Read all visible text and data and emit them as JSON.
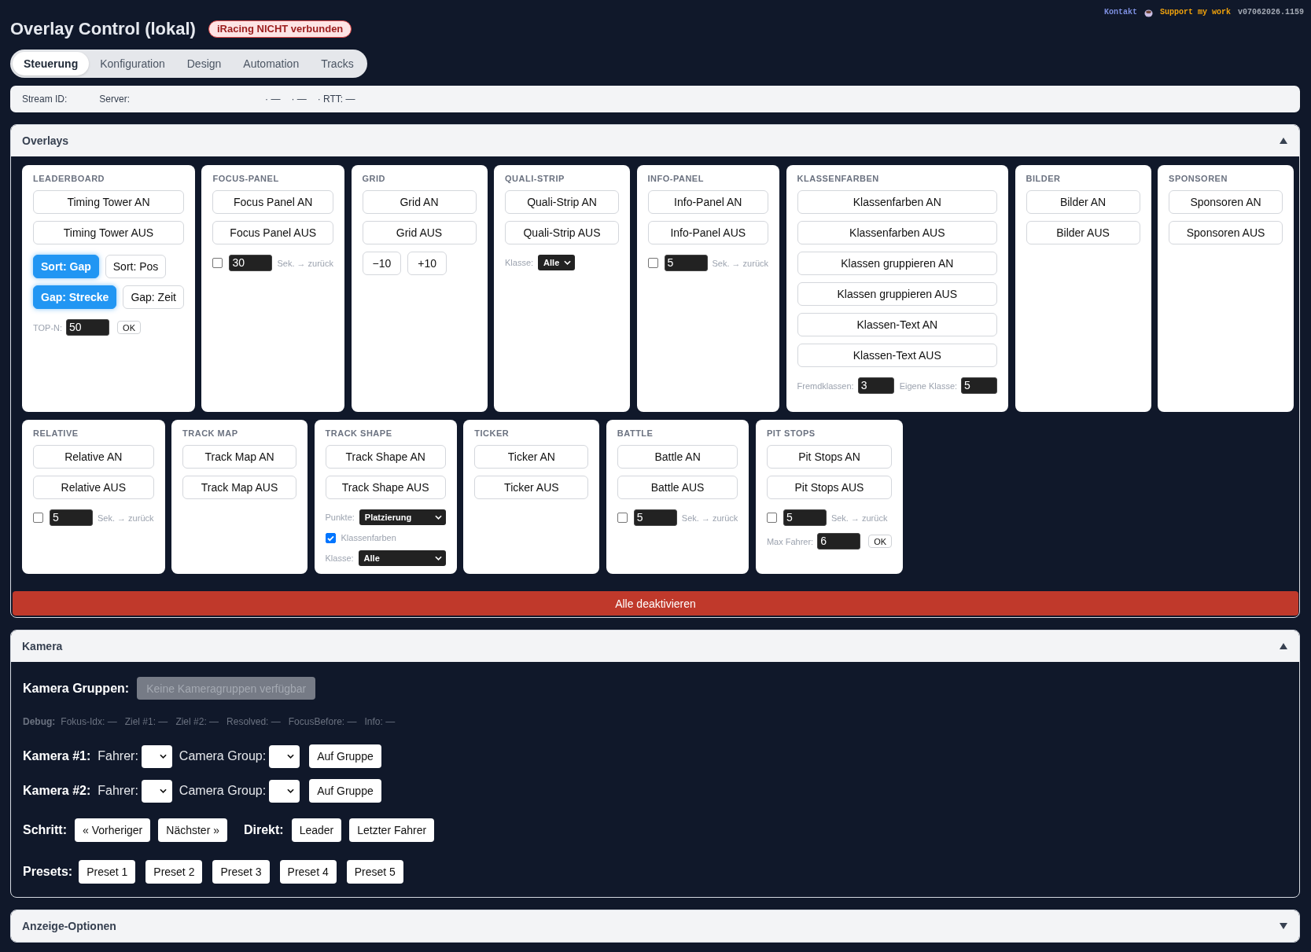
{
  "header": {
    "title": "Overlay Control (lokal)",
    "status_badge": "iRacing NICHT verbunden",
    "links": [
      {
        "kind": "contact",
        "text": "Kontakt"
      },
      {
        "kind": "support",
        "text": "Support my work"
      }
    ],
    "version": "v07062026.1159"
  },
  "tabs": [
    {
      "label": "Steuerung",
      "selected": true
    },
    {
      "label": "Konfiguration",
      "selected": false
    },
    {
      "label": "Design",
      "selected": false
    },
    {
      "label": "Automation",
      "selected": false
    },
    {
      "label": "Tracks",
      "selected": false
    }
  ],
  "stream_bar": {
    "labels": [
      "Stream ID:",
      "Server:"
    ],
    "indicators": [
      "· —",
      "· —",
      "· RTT: —"
    ]
  },
  "overlays": {
    "title": "Overlays",
    "expanded": true,
    "card_rows": [
      [
        {
          "title": "LEADERBOARD",
          "controls": [
            {
              "kind": "button",
              "label": "Timing Tower AN"
            },
            {
              "kind": "button",
              "label": "Timing Tower AUS"
            },
            {
              "kind": "toggles",
              "buttons": [
                {
                  "label": "Sort: Gap",
                  "selected": true
                },
                {
                  "label": "Sort: Pos",
                  "selected": false
                }
              ]
            },
            {
              "kind": "toggles",
              "buttons": [
                {
                  "label": "Gap: Strecke",
                  "selected": true
                },
                {
                  "label": "Gap: Zeit",
                  "selected": false
                }
              ]
            },
            {
              "kind": "number",
              "label": "TOP-N:",
              "value": "50",
              "button": "OK"
            }
          ]
        },
        {
          "title": "FOCUS-PANEL",
          "controls": [
            {
              "kind": "button",
              "label": "Focus Panel AN"
            },
            {
              "kind": "button",
              "label": "Focus Panel AUS"
            },
            {
              "kind": "timer",
              "checked": false,
              "value": "30",
              "suffix": "Sek. → zurück"
            }
          ]
        },
        {
          "title": "GRID",
          "controls": [
            {
              "kind": "button",
              "label": "Grid AN"
            },
            {
              "kind": "button",
              "label": "Grid AUS"
            },
            {
              "kind": "steps",
              "buttons": [
                "−10",
                "+10"
              ]
            }
          ]
        },
        {
          "title": "QUALI-STRIP",
          "controls": [
            {
              "kind": "button",
              "label": "Quali-Strip AN"
            },
            {
              "kind": "button",
              "label": "Quali-Strip AUS"
            },
            {
              "kind": "select",
              "label": "Klasse:",
              "value": "Alle"
            }
          ]
        },
        {
          "title": "INFO-PANEL",
          "controls": [
            {
              "kind": "button",
              "label": "Info-Panel AN"
            },
            {
              "kind": "button",
              "label": "Info-Panel AUS"
            },
            {
              "kind": "timer",
              "checked": false,
              "value": "5",
              "suffix": "Sek. → zurück"
            }
          ]
        },
        {
          "title": "KLASSENFARBEN",
          "controls": [
            {
              "kind": "button",
              "label": "Klassenfarben AN"
            },
            {
              "kind": "button",
              "label": "Klassenfarben AUS"
            },
            {
              "kind": "button",
              "label": "Klassen gruppieren AN"
            },
            {
              "kind": "button",
              "label": "Klassen gruppieren AUS"
            },
            {
              "kind": "button",
              "label": "Klassen-Text AN"
            },
            {
              "kind": "button",
              "label": "Klassen-Text AUS"
            },
            {
              "kind": "fields",
              "fields": [
                {
                  "label": "Fremdklassen:",
                  "value": "3"
                },
                {
                  "label": "Eigene Klasse:",
                  "value": "5"
                }
              ]
            }
          ]
        },
        {
          "title": "BILDER",
          "controls": [
            {
              "kind": "button",
              "label": "Bilder AN"
            },
            {
              "kind": "button",
              "label": "Bilder AUS"
            }
          ]
        },
        {
          "title": "SPONSOREN",
          "controls": [
            {
              "kind": "button",
              "label": "Sponsoren AN"
            },
            {
              "kind": "button",
              "label": "Sponsoren AUS"
            }
          ]
        }
      ],
      [
        {
          "title": "RELATIVE",
          "controls": [
            {
              "kind": "button",
              "label": "Relative AN"
            },
            {
              "kind": "button",
              "label": "Relative AUS"
            },
            {
              "kind": "timer",
              "checked": false,
              "value": "5",
              "suffix": "Sek. → zurück"
            }
          ]
        },
        {
          "title": "TRACK MAP",
          "controls": [
            {
              "kind": "button",
              "label": "Track Map AN"
            },
            {
              "kind": "button",
              "label": "Track Map AUS"
            }
          ]
        },
        {
          "title": "TRACK SHAPE",
          "controls": [
            {
              "kind": "button",
              "label": "Track Shape AN"
            },
            {
              "kind": "button",
              "label": "Track Shape AUS"
            },
            {
              "kind": "wideselect",
              "label": "Punkte:",
              "value": "Platzierung"
            },
            {
              "kind": "checkbox",
              "checked": true,
              "label": "Klassenfarben"
            },
            {
              "kind": "wideselect",
              "label": "Klasse:",
              "value": "Alle"
            }
          ]
        },
        {
          "title": "TICKER",
          "controls": [
            {
              "kind": "button",
              "label": "Ticker AN"
            },
            {
              "kind": "button",
              "label": "Ticker AUS"
            }
          ]
        },
        {
          "title": "BATTLE",
          "controls": [
            {
              "kind": "button",
              "label": "Battle AN"
            },
            {
              "kind": "button",
              "label": "Battle AUS"
            },
            {
              "kind": "timer",
              "checked": false,
              "value": "5",
              "suffix": "Sek. → zurück"
            }
          ]
        },
        {
          "title": "PIT STOPS",
          "controls": [
            {
              "kind": "button",
              "label": "Pit Stops AN"
            },
            {
              "kind": "button",
              "label": "Pit Stops AUS"
            },
            {
              "kind": "timer",
              "checked": false,
              "value": "5",
              "suffix": "Sek. → zurück"
            },
            {
              "kind": "number",
              "label": "Max Fahrer:",
              "value": "6",
              "button": "OK"
            }
          ]
        }
      ]
    ],
    "disable_all_button": "Alle deaktivieren"
  },
  "kamera": {
    "title": "Kamera",
    "expanded": true,
    "groups": {
      "label": "Kamera Gruppen:",
      "button": "Keine Kameragruppen verfügbar",
      "disabled": true
    },
    "debug": {
      "label": "Debug:",
      "items": [
        "Fokus-Idx: —",
        "Ziel #1: —",
        "Ziel #2: —",
        "Resolved: —",
        "FocusBefore: —",
        "Info: —"
      ]
    },
    "cameras": [
      {
        "label": "Kamera #1:",
        "driver_label": "Fahrer:",
        "group_label": "Camera Group:",
        "button": "Auf Gruppe"
      },
      {
        "label": "Kamera #2:",
        "driver_label": "Fahrer:",
        "group_label": "Camera Group:",
        "button": "Auf Gruppe"
      }
    ],
    "navigation": [
      {
        "label": "Schritt:",
        "buttons": [
          "« Vorheriger",
          "Nächster »"
        ]
      },
      {
        "label": "Direkt:",
        "buttons": [
          "Leader",
          "Letzter Fahrer"
        ]
      }
    ],
    "presets": {
      "label": "Presets:",
      "buttons": [
        "Preset 1",
        "Preset 2",
        "Preset 3",
        "Preset 4",
        "Preset 5"
      ]
    }
  },
  "display_options": {
    "title": "Anzeige-Optionen",
    "expanded": false
  }
}
